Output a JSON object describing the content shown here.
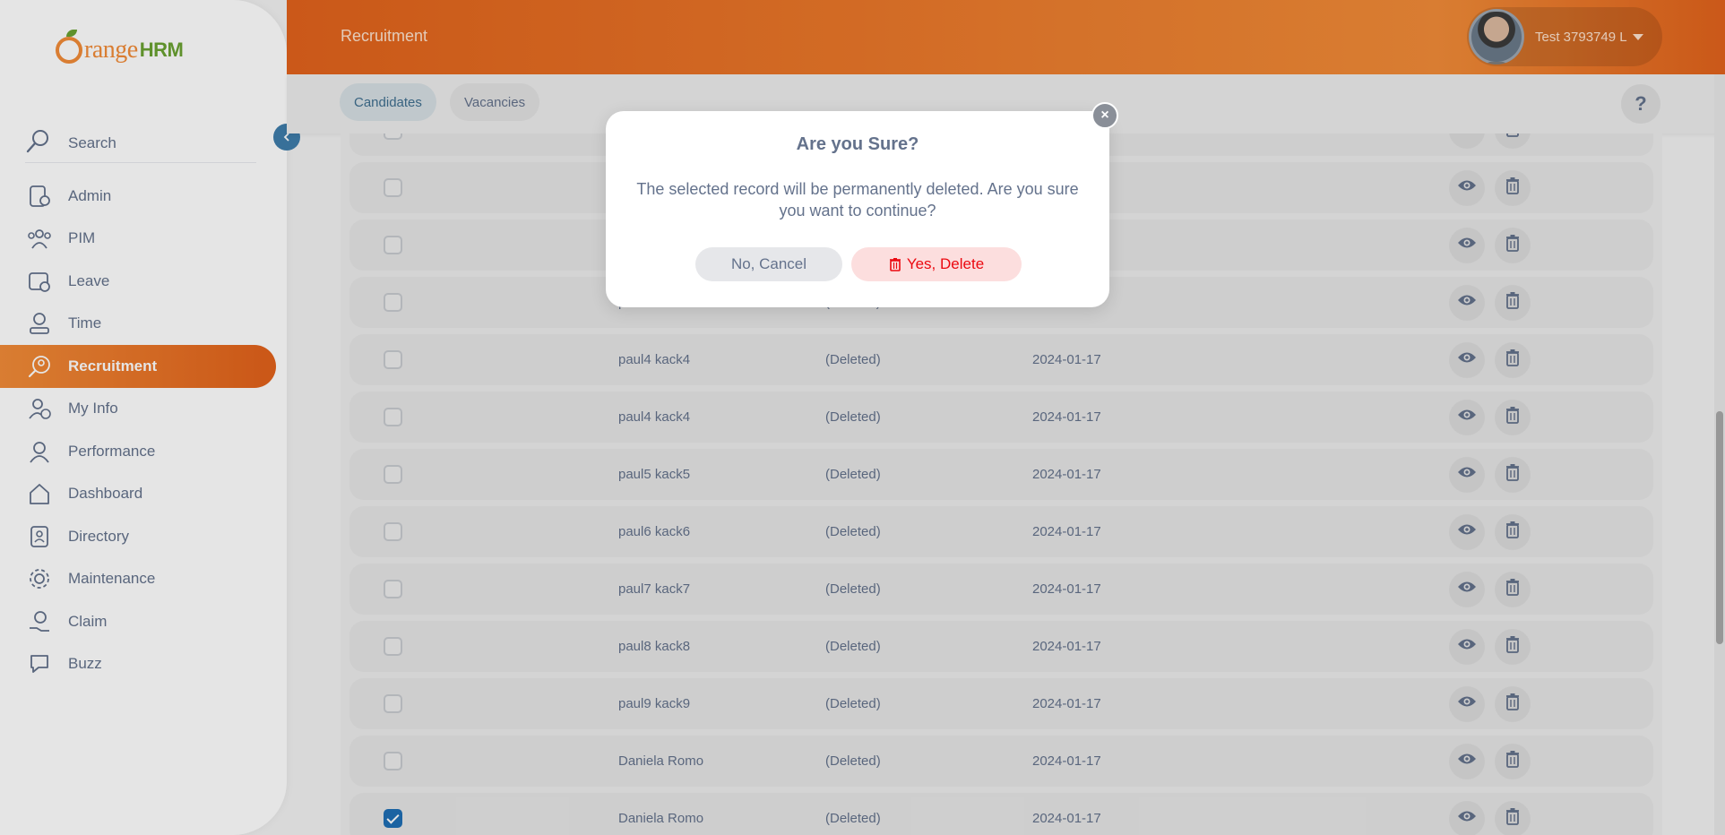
{
  "app": {
    "brand_orange": "range",
    "brand_hrm": "HRM"
  },
  "colors": {
    "accent": "#f28c38",
    "accent_dark": "#e2611a",
    "primary_blue": "#1f6fb5",
    "danger": "#eb0910"
  },
  "sidebar": {
    "search_label": "Search",
    "items": [
      {
        "label": "Admin",
        "icon": "admin-icon"
      },
      {
        "label": "PIM",
        "icon": "pim-icon"
      },
      {
        "label": "Leave",
        "icon": "leave-icon"
      },
      {
        "label": "Time",
        "icon": "time-icon"
      },
      {
        "label": "Recruitment",
        "icon": "recruitment-icon",
        "active": true
      },
      {
        "label": "My Info",
        "icon": "my-info-icon"
      },
      {
        "label": "Performance",
        "icon": "performance-icon"
      },
      {
        "label": "Dashboard",
        "icon": "dashboard-icon"
      },
      {
        "label": "Directory",
        "icon": "directory-icon"
      },
      {
        "label": "Maintenance",
        "icon": "maintenance-icon"
      },
      {
        "label": "Claim",
        "icon": "claim-icon"
      },
      {
        "label": "Buzz",
        "icon": "buzz-icon"
      }
    ]
  },
  "header": {
    "title": "Recruitment",
    "user_name": "Test 3793749 L"
  },
  "tabs": {
    "candidates": "Candidates",
    "vacancies": "Vacancies",
    "help": "?"
  },
  "table": {
    "rows": [
      {
        "name": "",
        "status": "",
        "date": "",
        "checked": false
      },
      {
        "name": "",
        "status": "",
        "date": "",
        "checked": false
      },
      {
        "name": "",
        "status": "",
        "date": "",
        "checked": false
      },
      {
        "name": "paul4 kack4",
        "status": "(Deleted)",
        "date": "2024-01-17",
        "checked": false
      },
      {
        "name": "paul4 kack4",
        "status": "(Deleted)",
        "date": "2024-01-17",
        "checked": false
      },
      {
        "name": "paul4 kack4",
        "status": "(Deleted)",
        "date": "2024-01-17",
        "checked": false
      },
      {
        "name": "paul5 kack5",
        "status": "(Deleted)",
        "date": "2024-01-17",
        "checked": false
      },
      {
        "name": "paul6 kack6",
        "status": "(Deleted)",
        "date": "2024-01-17",
        "checked": false
      },
      {
        "name": "paul7 kack7",
        "status": "(Deleted)",
        "date": "2024-01-17",
        "checked": false
      },
      {
        "name": "paul8 kack8",
        "status": "(Deleted)",
        "date": "2024-01-17",
        "checked": false
      },
      {
        "name": "paul9 kack9",
        "status": "(Deleted)",
        "date": "2024-01-17",
        "checked": false
      },
      {
        "name": "Daniela Romo",
        "status": "(Deleted)",
        "date": "2024-01-17",
        "checked": false
      },
      {
        "name": "Daniela Romo",
        "status": "(Deleted)",
        "date": "2024-01-17",
        "checked": true
      }
    ]
  },
  "dialog": {
    "title": "Are you Sure?",
    "message": "The selected record will be permanently deleted. Are you sure you want to continue?",
    "cancel_label": "No, Cancel",
    "confirm_label": "Yes, Delete",
    "close_glyph": "×"
  }
}
